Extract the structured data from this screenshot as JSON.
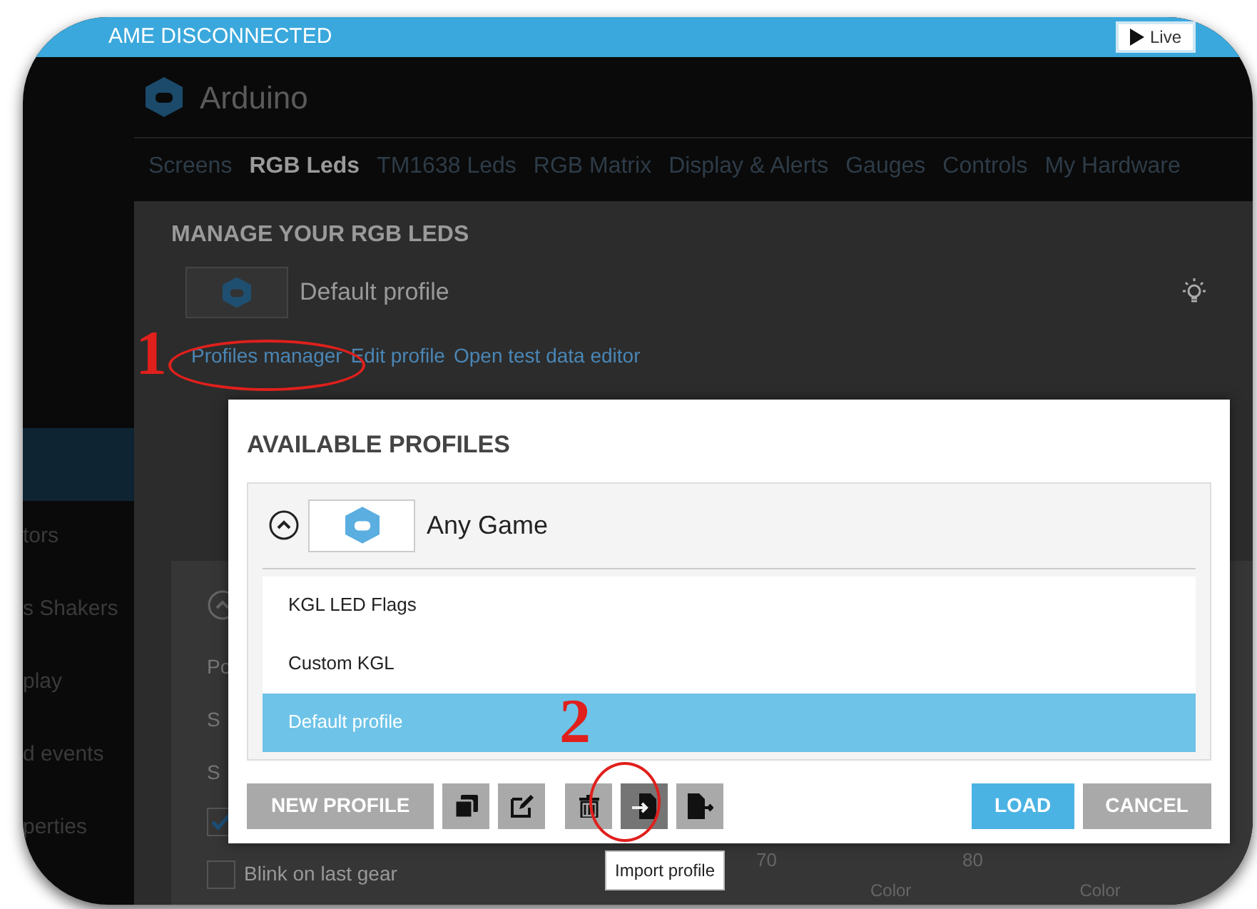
{
  "status_bar": {
    "text": "AME DISCONNECTED",
    "live_button": "Live"
  },
  "device": {
    "title": "Arduino"
  },
  "tabs": [
    {
      "label": "Screens",
      "selected": false
    },
    {
      "label": "RGB Leds",
      "selected": true
    },
    {
      "label": "TM1638 Leds",
      "selected": false
    },
    {
      "label": "RGB Matrix",
      "selected": false
    },
    {
      "label": "Display & Alerts",
      "selected": false
    },
    {
      "label": "Gauges",
      "selected": false
    },
    {
      "label": "Controls",
      "selected": false
    },
    {
      "label": "My Hardware",
      "selected": false
    }
  ],
  "sidebar": {
    "items": [
      {
        "selected": true
      },
      {
        "label": "tors",
        "selected": false
      },
      {
        "label": "s Shakers",
        "selected": false
      },
      {
        "label": "play",
        "selected": false
      },
      {
        "label": "d events",
        "selected": false
      },
      {
        "label": "perties",
        "selected": false
      }
    ]
  },
  "page": {
    "heading": "MANAGE YOUR RGB LEDS",
    "profile_name": "Default profile",
    "links": [
      "Profiles manager",
      "Edit profile",
      "Open test data editor"
    ]
  },
  "section": {
    "expanded": true,
    "rows": [
      "Po",
      "S",
      "S"
    ],
    "checkboxes": [
      {
        "checked": true
      },
      {
        "label": "Blink on last gear",
        "checked": false
      }
    ],
    "values": [
      "70",
      "80"
    ],
    "color_labels": [
      "Color",
      "Color"
    ]
  },
  "dialog": {
    "title": "AVAILABLE PROFILES",
    "group": {
      "name": "Any Game",
      "expanded": true
    },
    "profiles": [
      {
        "name": "KGL LED Flags",
        "selected": false
      },
      {
        "name": "Custom KGL",
        "selected": false
      },
      {
        "name": "Default profile",
        "selected": true
      }
    ],
    "tools": [
      {
        "kind": "text",
        "label": "NEW PROFILE",
        "hovered": false
      },
      {
        "kind": "copy",
        "hovered": false
      },
      {
        "kind": "edit",
        "hovered": false
      },
      {
        "kind": "delete",
        "hovered": false
      },
      {
        "kind": "import",
        "hovered": true
      },
      {
        "kind": "export",
        "hovered": false
      }
    ],
    "load_button": "LOAD",
    "cancel_button": "CANCEL"
  },
  "tooltip": "Import profile",
  "annotations": [
    "1",
    "2"
  ]
}
